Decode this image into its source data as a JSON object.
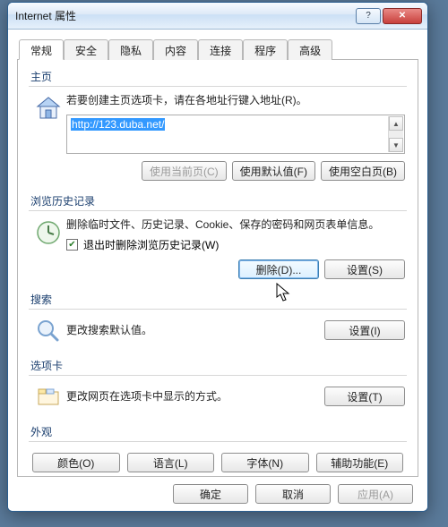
{
  "window": {
    "title": "Internet 属性"
  },
  "tabs": [
    "常规",
    "安全",
    "隐私",
    "内容",
    "连接",
    "程序",
    "高级"
  ],
  "active_tab_index": 0,
  "homepage": {
    "label": "主页",
    "hint": "若要创建主页选项卡，请在各地址行键入地址(R)。",
    "url": "http://123.duba.net/",
    "buttons": {
      "use_current": "使用当前页(C)",
      "use_default": "使用默认值(F)",
      "use_blank": "使用空白页(B)"
    }
  },
  "history": {
    "label": "浏览历史记录",
    "desc": "删除临时文件、历史记录、Cookie、保存的密码和网页表单信息。",
    "checkbox_label": "退出时删除浏览历史记录(W)",
    "checkbox_checked": true,
    "buttons": {
      "delete": "删除(D)...",
      "settings": "设置(S)"
    }
  },
  "search": {
    "label": "搜索",
    "desc": "更改搜索默认值。",
    "button": "设置(I)"
  },
  "tabs_section": {
    "label": "选项卡",
    "desc": "更改网页在选项卡中显示的方式。",
    "button": "设置(T)"
  },
  "appearance": {
    "label": "外观",
    "buttons": [
      "颜色(O)",
      "语言(L)",
      "字体(N)",
      "辅助功能(E)"
    ]
  },
  "footer": {
    "ok": "确定",
    "cancel": "取消",
    "apply": "应用(A)"
  }
}
